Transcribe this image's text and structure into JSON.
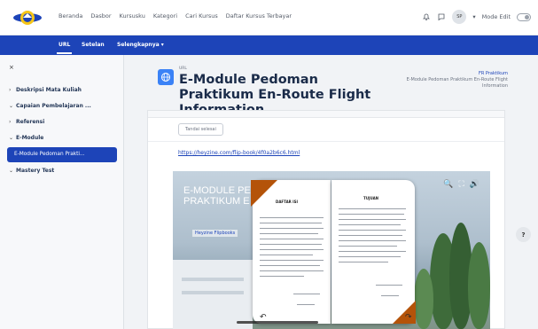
{
  "topbar": {
    "nav": [
      "Beranda",
      "Dasbor",
      "Kursusku",
      "Kategori",
      "Cari Kursus",
      "Daftar Kursus Terbayar"
    ],
    "avatar_initials": "SP",
    "edit_mode_label": "Mode Edit"
  },
  "secnav": {
    "items": [
      "URL",
      "Setelan",
      "Selengkapnya ▾"
    ]
  },
  "sidebar": {
    "close_label": "×",
    "items": [
      {
        "caret": "›",
        "label": "Deskripsi Mata Kuliah"
      },
      {
        "caret": "⌄",
        "label": "Capaian Pembelajaran ..."
      },
      {
        "caret": "›",
        "label": "Referensi"
      },
      {
        "caret": "⌄",
        "label": "E-Module"
      },
      {
        "caret": "⌄",
        "label": "Mastery Test"
      }
    ],
    "active_item": "E-Module Pedoman Prakti..."
  },
  "header": {
    "kicker": "URL",
    "title": "E-Module Pedoman Praktikum En-Route Flight Information",
    "breadcrumb_link": "FR Praktikum",
    "breadcrumb_rest": "E-Module Pedoman Praktikum En-Route Flight Information"
  },
  "content": {
    "done_button": "Tandai selesai",
    "url_text": "https://heyzine.com/flip-book/4f0a2b6c6.html",
    "bg_heading_line1": "E-MODULE PE",
    "bg_heading_line2": "PRAKTIKUM E",
    "bg_brand": "Heyzine Flipbooks",
    "left_page_heading": "DAFTAR ISI",
    "right_page_heading": "TUJUAN",
    "tools": [
      "🔍",
      "⛶",
      "🔊"
    ]
  },
  "help_label": "?"
}
